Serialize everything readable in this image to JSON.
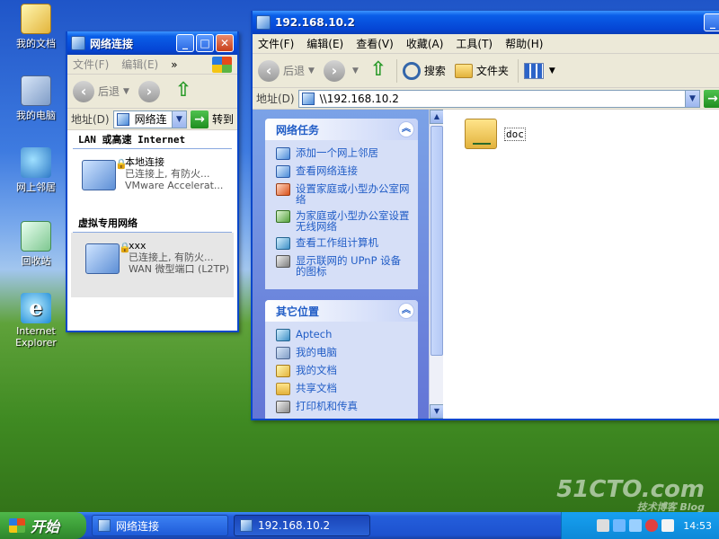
{
  "desktop": {
    "icons": [
      {
        "label": "我的文档",
        "icon": "my-documents-icon"
      },
      {
        "label": "我的电脑",
        "icon": "my-computer-icon"
      },
      {
        "label": "网上邻居",
        "icon": "network-places-icon"
      },
      {
        "label": "回收站",
        "icon": "recycle-bin-icon"
      },
      {
        "label": "Internet Explorer",
        "icon": "ie-icon"
      }
    ]
  },
  "network_window": {
    "title": "网络连接",
    "menu": [
      "文件(F)",
      "编辑(E)"
    ],
    "menu_more": "»",
    "back_label": "后退",
    "address_label": "地址(D)",
    "address_value": "网络连",
    "goto_label": "转到",
    "groups": [
      {
        "header": "LAN 或高速 Internet",
        "items": [
          {
            "name": "本地连接",
            "status": "已连接上, 有防火...",
            "device": "VMware Accelerat..."
          }
        ]
      },
      {
        "header": "虚拟专用网络",
        "items": [
          {
            "name": "xxx",
            "status": "已连接上, 有防火...",
            "device": "WAN 微型端口 (L2TP)"
          }
        ]
      }
    ]
  },
  "explorer_window": {
    "title": "192.168.10.2",
    "menu": [
      "文件(F)",
      "编辑(E)",
      "查看(V)",
      "收藏(A)",
      "工具(T)",
      "帮助(H)"
    ],
    "toolbar": {
      "back_label": "后退",
      "search_label": "搜索",
      "folders_label": "文件夹"
    },
    "address_label": "地址(D)",
    "address_value": "\\\\192.168.10.2",
    "tasks_panel": {
      "title": "网络任务",
      "items": [
        "添加一个网上邻居",
        "查看网络连接",
        "设置家庭或小型办公室网络",
        "为家庭或小型办公室设置无线网络",
        "查看工作组计算机",
        "显示联网的 UPnP 设备的图标"
      ]
    },
    "places_panel": {
      "title": "其它位置",
      "items": [
        "Aptech",
        "我的电脑",
        "我的文档",
        "共享文档",
        "打印机和传真"
      ]
    },
    "shares": [
      {
        "name": "doc"
      }
    ]
  },
  "taskbar": {
    "start_label": "开始",
    "buttons": [
      "网络连接",
      "192.168.10.2"
    ],
    "clock": "14:53"
  },
  "watermark": {
    "brand": "51CTO.com",
    "sub": "技术博客 Blog"
  }
}
